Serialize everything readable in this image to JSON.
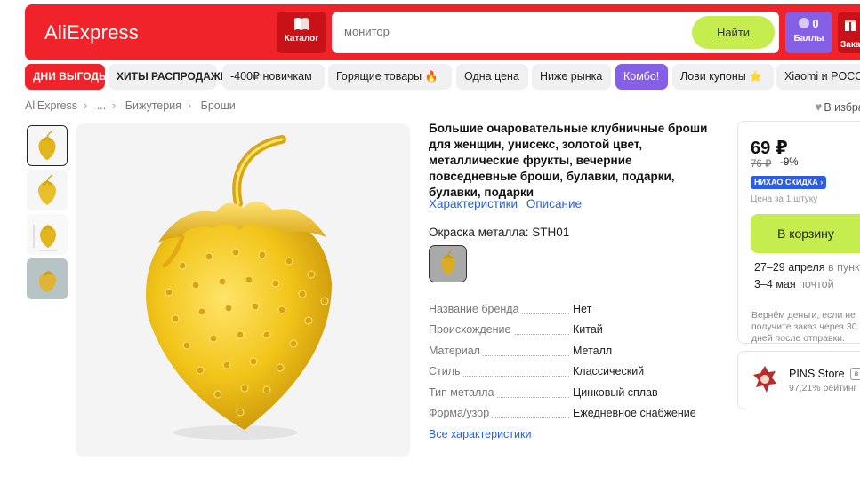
{
  "header": {
    "logo": "AliExpress",
    "catalog_label": "Каталог",
    "search_placeholder": "монитор",
    "search_button": "Найти",
    "points_count": "0",
    "points_label": "Баллы",
    "orders_label": "Заказы"
  },
  "pills": [
    {
      "label": "ДНИ ВЫГОДЫ",
      "style": "red"
    },
    {
      "label": "ХИТЫ РАСПРОДАЖИ",
      "style": "bold"
    },
    {
      "label": "-400₽ новичкам",
      "style": "plain"
    },
    {
      "label": "Горящие товары",
      "style": "plain",
      "emoji": "🔥"
    },
    {
      "label": "Одна цена",
      "style": "plain"
    },
    {
      "label": "Ниже рынка",
      "style": "plain"
    },
    {
      "label": "Комбо!",
      "style": "purple"
    },
    {
      "label": "Лови купоны",
      "style": "plain",
      "emoji": "⭐"
    },
    {
      "label": "Xiaomi и POCO",
      "style": "plain"
    }
  ],
  "breadcrumb": [
    "AliExpress",
    "...",
    "Бижутерия",
    "Броши"
  ],
  "wishlist_label": "В избранное",
  "product": {
    "title": "Большие очаровательные клубничные броши для женщин, унисекс, золотой цвет, металлические фрукты, вечерние повседневные броши, булавки, подарки, булавки, подарки",
    "link_characteristics": "Характеристики",
    "link_description": "Описание",
    "color_label": "Окраска металла: STH01",
    "specs": [
      {
        "key": "Название бренда",
        "value": "Нет"
      },
      {
        "key": "Происхождение",
        "value": "Китай"
      },
      {
        "key": "Материал",
        "value": "Металл"
      },
      {
        "key": "Стиль",
        "value": "Классический"
      },
      {
        "key": "Тип металла",
        "value": "Цинковый сплав"
      },
      {
        "key": "Форма/узор",
        "value": "Ежедневное снабжение"
      }
    ],
    "all_specs_link": "Все характеристики"
  },
  "buy_box": {
    "price": "69 ₽",
    "old_price": "76 ₽",
    "discount": "-9%",
    "badge": "НИХАО СКИДКА ›",
    "per_unit": "Цена за 1 штуку",
    "cart_button": "В корзину",
    "delivery_1_date": "27–29 апреля",
    "delivery_1_mode": "в пункт",
    "delivery_2_date": "3–4 мая",
    "delivery_2_mode": "почтой",
    "refund_note": "Вернём деньги, если не получите заказ через 30 дней после отправки."
  },
  "store": {
    "name": "PINS Store",
    "tag": "в",
    "rating": "97,21% рейтинг"
  },
  "colors": {
    "brand_red": "#f0232b",
    "accent_green": "#c6ed4e",
    "accent_purple": "#8560e6",
    "link_blue": "#2a5fd3"
  }
}
